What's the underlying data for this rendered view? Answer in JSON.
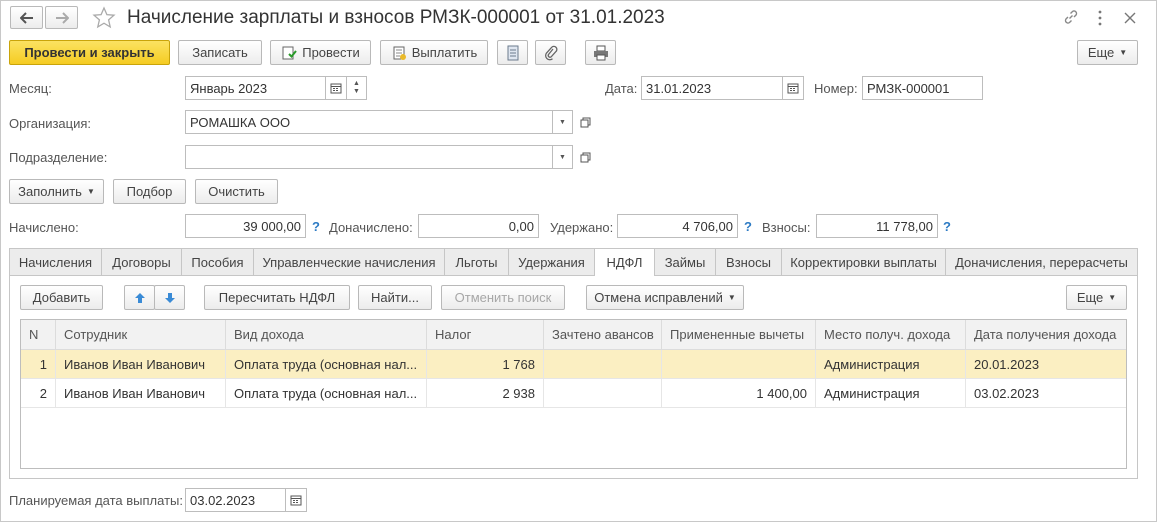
{
  "window": {
    "title": "Начисление зарплаты и взносов РМЗК-000001 от 31.01.2023"
  },
  "toolbar": {
    "post_close": "Провести и закрыть",
    "write": "Записать",
    "post": "Провести",
    "pay": "Выплатить",
    "more": "Еще"
  },
  "header": {
    "month_label": "Месяц:",
    "month_value": "Январь 2023",
    "date_label": "Дата:",
    "date_value": "31.01.2023",
    "number_label": "Номер:",
    "number_value": "РМЗК-000001",
    "org_label": "Организация:",
    "org_value": "РОМАШКА ООО",
    "dept_label": "Подразделение:",
    "dept_value": ""
  },
  "actions": {
    "fill": "Заполнить",
    "select": "Подбор",
    "clear": "Очистить"
  },
  "totals": {
    "accrued_label": "Начислено:",
    "accrued_value": "39 000,00",
    "extra_label": "Доначислено:",
    "extra_value": "0,00",
    "withheld_label": "Удержано:",
    "withheld_value": "4 706,00",
    "contrib_label": "Взносы:",
    "contrib_value": "11 778,00",
    "help": "?"
  },
  "tabs": [
    "Начисления",
    "Договоры",
    "Пособия",
    "Управленческие начисления",
    "Льготы",
    "Удержания",
    "НДФЛ",
    "Займы",
    "Взносы",
    "Корректировки выплаты",
    "Доначисления, перерасчеты"
  ],
  "active_tab": "НДФЛ",
  "ndfl": {
    "add": "Добавить",
    "recalc": "Пересчитать НДФЛ",
    "find": "Найти...",
    "cancel_search": "Отменить поиск",
    "cancel_fix": "Отмена исправлений",
    "more": "Еще",
    "columns": [
      "N",
      "Сотрудник",
      "Вид дохода",
      "Налог",
      "Зачтено авансов",
      "Примененные вычеты",
      "Место получ. дохода",
      "Дата получения дохода"
    ],
    "rows": [
      {
        "n": "1",
        "employee": "Иванов Иван Иванович",
        "income": "Оплата труда (основная нал...",
        "tax": "1 768",
        "advances": "",
        "deductions": "",
        "place": "Администрация",
        "date": "20.01.2023"
      },
      {
        "n": "2",
        "employee": "Иванов Иван Иванович",
        "income": "Оплата труда (основная нал...",
        "tax": "2 938",
        "advances": "",
        "deductions": "1 400,00",
        "place": "Администрация",
        "date": "03.02.2023"
      }
    ]
  },
  "footer": {
    "planned_label": "Планируемая дата выплаты:",
    "planned_value": "03.02.2023"
  },
  "colors": {
    "primary_button": "#f5cc22",
    "selected_row": "#fbefc2",
    "help_link": "#2d7bc4"
  }
}
